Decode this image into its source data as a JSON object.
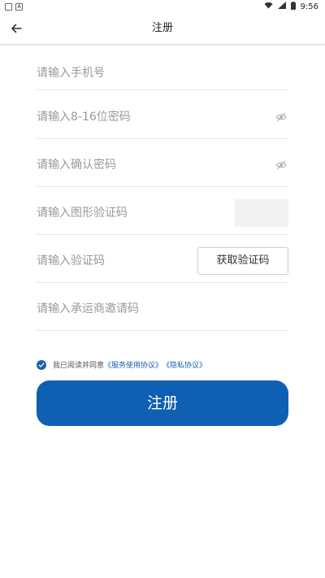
{
  "status": {
    "time": "9:56",
    "left_icon_text": "A"
  },
  "header": {
    "title": "注册"
  },
  "form": {
    "phone_placeholder": "请输入手机号",
    "password_placeholder": "请输入8-16位密码",
    "confirm_placeholder": "请输入确认密码",
    "captcha_placeholder": "请输入图形验证码",
    "sms_placeholder": "请输入验证码",
    "sms_button": "获取验证码",
    "invite_placeholder": "请输入承运商邀请码"
  },
  "agreement": {
    "prefix": "我已阅读并同意",
    "service_link": "《服务使用协议》",
    "privacy_link": "《隐私协议》",
    "checked": true
  },
  "submit_label": "注册",
  "colors": {
    "accent": "#0f5fb3",
    "link": "#1a5fb0"
  }
}
